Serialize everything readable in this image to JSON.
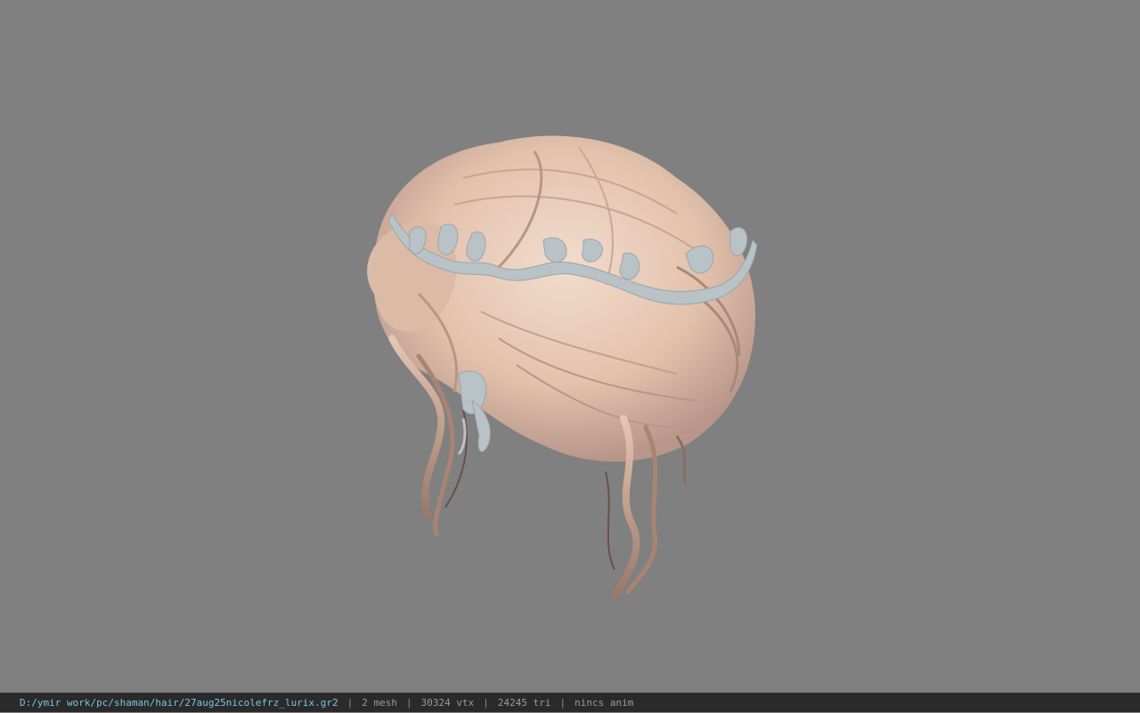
{
  "viewport": {
    "background": "#808080",
    "model_name": "hair-model-3d"
  },
  "status_bar": {
    "file_path": "D:/ymir work/pc/shaman/hair/27aug25nicolefrz_lurix.gr2",
    "separator": "|",
    "mesh_count": "2 mesh",
    "vertex_count": "30324 vtx",
    "triangle_count": "24245 tri",
    "anim_status": "nincs anim"
  },
  "colors": {
    "hair_base": "#e8c8b4",
    "hair_shadow": "#a88a78",
    "circlet": "#b9c2c6",
    "path_text": "#7ec3e0"
  }
}
